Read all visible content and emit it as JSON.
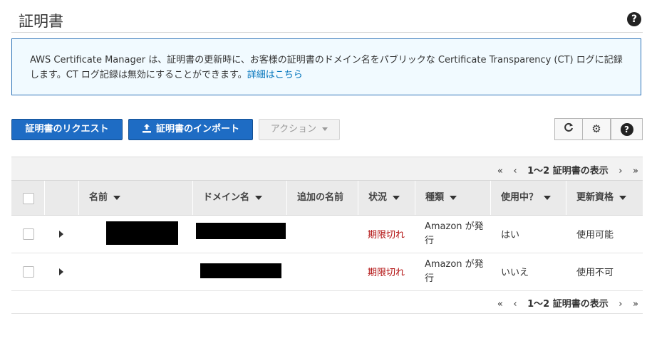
{
  "page": {
    "title": "証明書"
  },
  "info": {
    "text": "AWS Certificate Manager は、証明書の更新時に、お客様の証明書のドメイン名をパブリックな Certificate Transparency (CT) ログに記録します。CT ログ記録は無効にすることができます。",
    "link": "詳細はこちら"
  },
  "toolbar": {
    "request_label": "証明書のリクエスト",
    "import_label": "証明書のインポート",
    "actions_label": "アクション"
  },
  "pager": {
    "first": "«",
    "prev": "‹",
    "range": "1〜2 証明書の表示",
    "next": "›",
    "last": "»"
  },
  "table": {
    "columns": [
      "名前",
      "ドメイン名",
      "追加の名前",
      "状況",
      "種類",
      "使用中？",
      "更新資格"
    ],
    "rows": [
      {
        "name": "",
        "domain": "",
        "additional": "",
        "status": "期限切れ",
        "type": "Amazon が発行",
        "in_use": "はい",
        "renewal": "使用可能"
      },
      {
        "name": "",
        "domain": "",
        "additional": "",
        "status": "期限切れ",
        "type": "Amazon が発行",
        "in_use": "いいえ",
        "renewal": "使用不可"
      }
    ]
  },
  "icons": {
    "help": "question-circle-icon",
    "refresh": "refresh-icon",
    "settings": "gear-icon",
    "upload": "upload-icon"
  },
  "colors": {
    "primary": "#1e6cc4",
    "expired": "#b10d0d",
    "info_border": "#2e73b8",
    "info_bg": "#f1faff"
  }
}
